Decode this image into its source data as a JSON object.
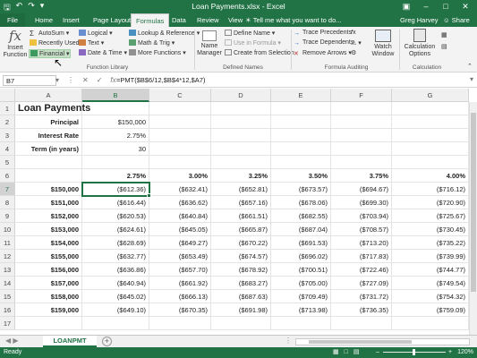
{
  "window": {
    "title": "Loan Payments.xlsx - Excel",
    "qat_icons": [
      "save-icon",
      "undo-icon",
      "redo-icon",
      "customize-icon"
    ],
    "controls": [
      "ribbon-display-icon",
      "minimize-icon",
      "maximize-icon",
      "close-icon"
    ]
  },
  "ribbon": {
    "tabs": [
      "File",
      "Home",
      "Insert",
      "Page Layout",
      "Formulas",
      "Data",
      "Review",
      "View"
    ],
    "active_tab": "Formulas",
    "tell_me": "Tell me what you want to do...",
    "user": "Greg Harvey",
    "share": "Share",
    "function_library": {
      "insert_function": "Insert\nFunction",
      "col1": [
        "AutoSum",
        "Recently Used",
        "Financial"
      ],
      "col2": [
        "Logical",
        "Text",
        "Date & Time"
      ],
      "col3": [
        "Lookup & Reference",
        "Math & Trig",
        "More Functions"
      ],
      "label": "Function Library"
    },
    "defined_names": {
      "name_manager": "Name\nManager",
      "items": [
        "Define Name",
        "Use in Formula",
        "Create from Selection"
      ],
      "label": "Defined Names"
    },
    "formula_auditing": {
      "items": [
        "Trace Precedents",
        "Trace Dependents",
        "Remove Arrows"
      ],
      "watch_window": "Watch\nWindow",
      "label": "Formula Auditing"
    },
    "calculation": {
      "options": "Calculation\nOptions",
      "label": "Calculation"
    }
  },
  "formula_bar": {
    "name_box": "B7",
    "formula": "=PMT($B$6/12,$B$4*12,$A7)"
  },
  "grid": {
    "columns": [
      "A",
      "B",
      "C",
      "D",
      "E",
      "F",
      "G"
    ],
    "selected_column": "B",
    "selected_row": 7,
    "title": "Loan Payments",
    "inputs": [
      {
        "label": "Principal",
        "value": "$150,000"
      },
      {
        "label": "Interest Rate",
        "value": "2.75%"
      },
      {
        "label": "Term (in years)",
        "value": "30"
      }
    ],
    "rates": [
      "2.75%",
      "3.00%",
      "3.25%",
      "3.50%",
      "3.75%",
      "4.00%"
    ],
    "table": [
      {
        "principal": "$150,000",
        "payments": [
          "($612.36)",
          "($632.41)",
          "($652.81)",
          "($673.57)",
          "($694.67)",
          "($716.12)"
        ]
      },
      {
        "principal": "$151,000",
        "payments": [
          "($616.44)",
          "($636.62)",
          "($657.16)",
          "($678.06)",
          "($699.30)",
          "($720.90)"
        ]
      },
      {
        "principal": "$152,000",
        "payments": [
          "($620.53)",
          "($640.84)",
          "($661.51)",
          "($682.55)",
          "($703.94)",
          "($725.67)"
        ]
      },
      {
        "principal": "$153,000",
        "payments": [
          "($624.61)",
          "($645.05)",
          "($665.87)",
          "($687.04)",
          "($708.57)",
          "($730.45)"
        ]
      },
      {
        "principal": "$154,000",
        "payments": [
          "($628.69)",
          "($649.27)",
          "($670.22)",
          "($691.53)",
          "($713.20)",
          "($735.22)"
        ]
      },
      {
        "principal": "$155,000",
        "payments": [
          "($632.77)",
          "($653.49)",
          "($674.57)",
          "($696.02)",
          "($717.83)",
          "($739.99)"
        ]
      },
      {
        "principal": "$156,000",
        "payments": [
          "($636.86)",
          "($657.70)",
          "($678.92)",
          "($700.51)",
          "($722.46)",
          "($744.77)"
        ]
      },
      {
        "principal": "$157,000",
        "payments": [
          "($640.94)",
          "($661.92)",
          "($683.27)",
          "($705.00)",
          "($727.09)",
          "($749.54)"
        ]
      },
      {
        "principal": "$158,000",
        "payments": [
          "($645.02)",
          "($666.13)",
          "($687.63)",
          "($709.49)",
          "($731.72)",
          "($754.32)"
        ]
      },
      {
        "principal": "$159,000",
        "payments": [
          "($649.10)",
          "($670.35)",
          "($691.98)",
          "($713.98)",
          "($736.35)",
          "($759.09)"
        ]
      }
    ]
  },
  "sheets": {
    "active": "LOANPMT"
  },
  "status": {
    "ready": "Ready",
    "zoom": "120%"
  },
  "colors": {
    "accent": "#217346"
  }
}
